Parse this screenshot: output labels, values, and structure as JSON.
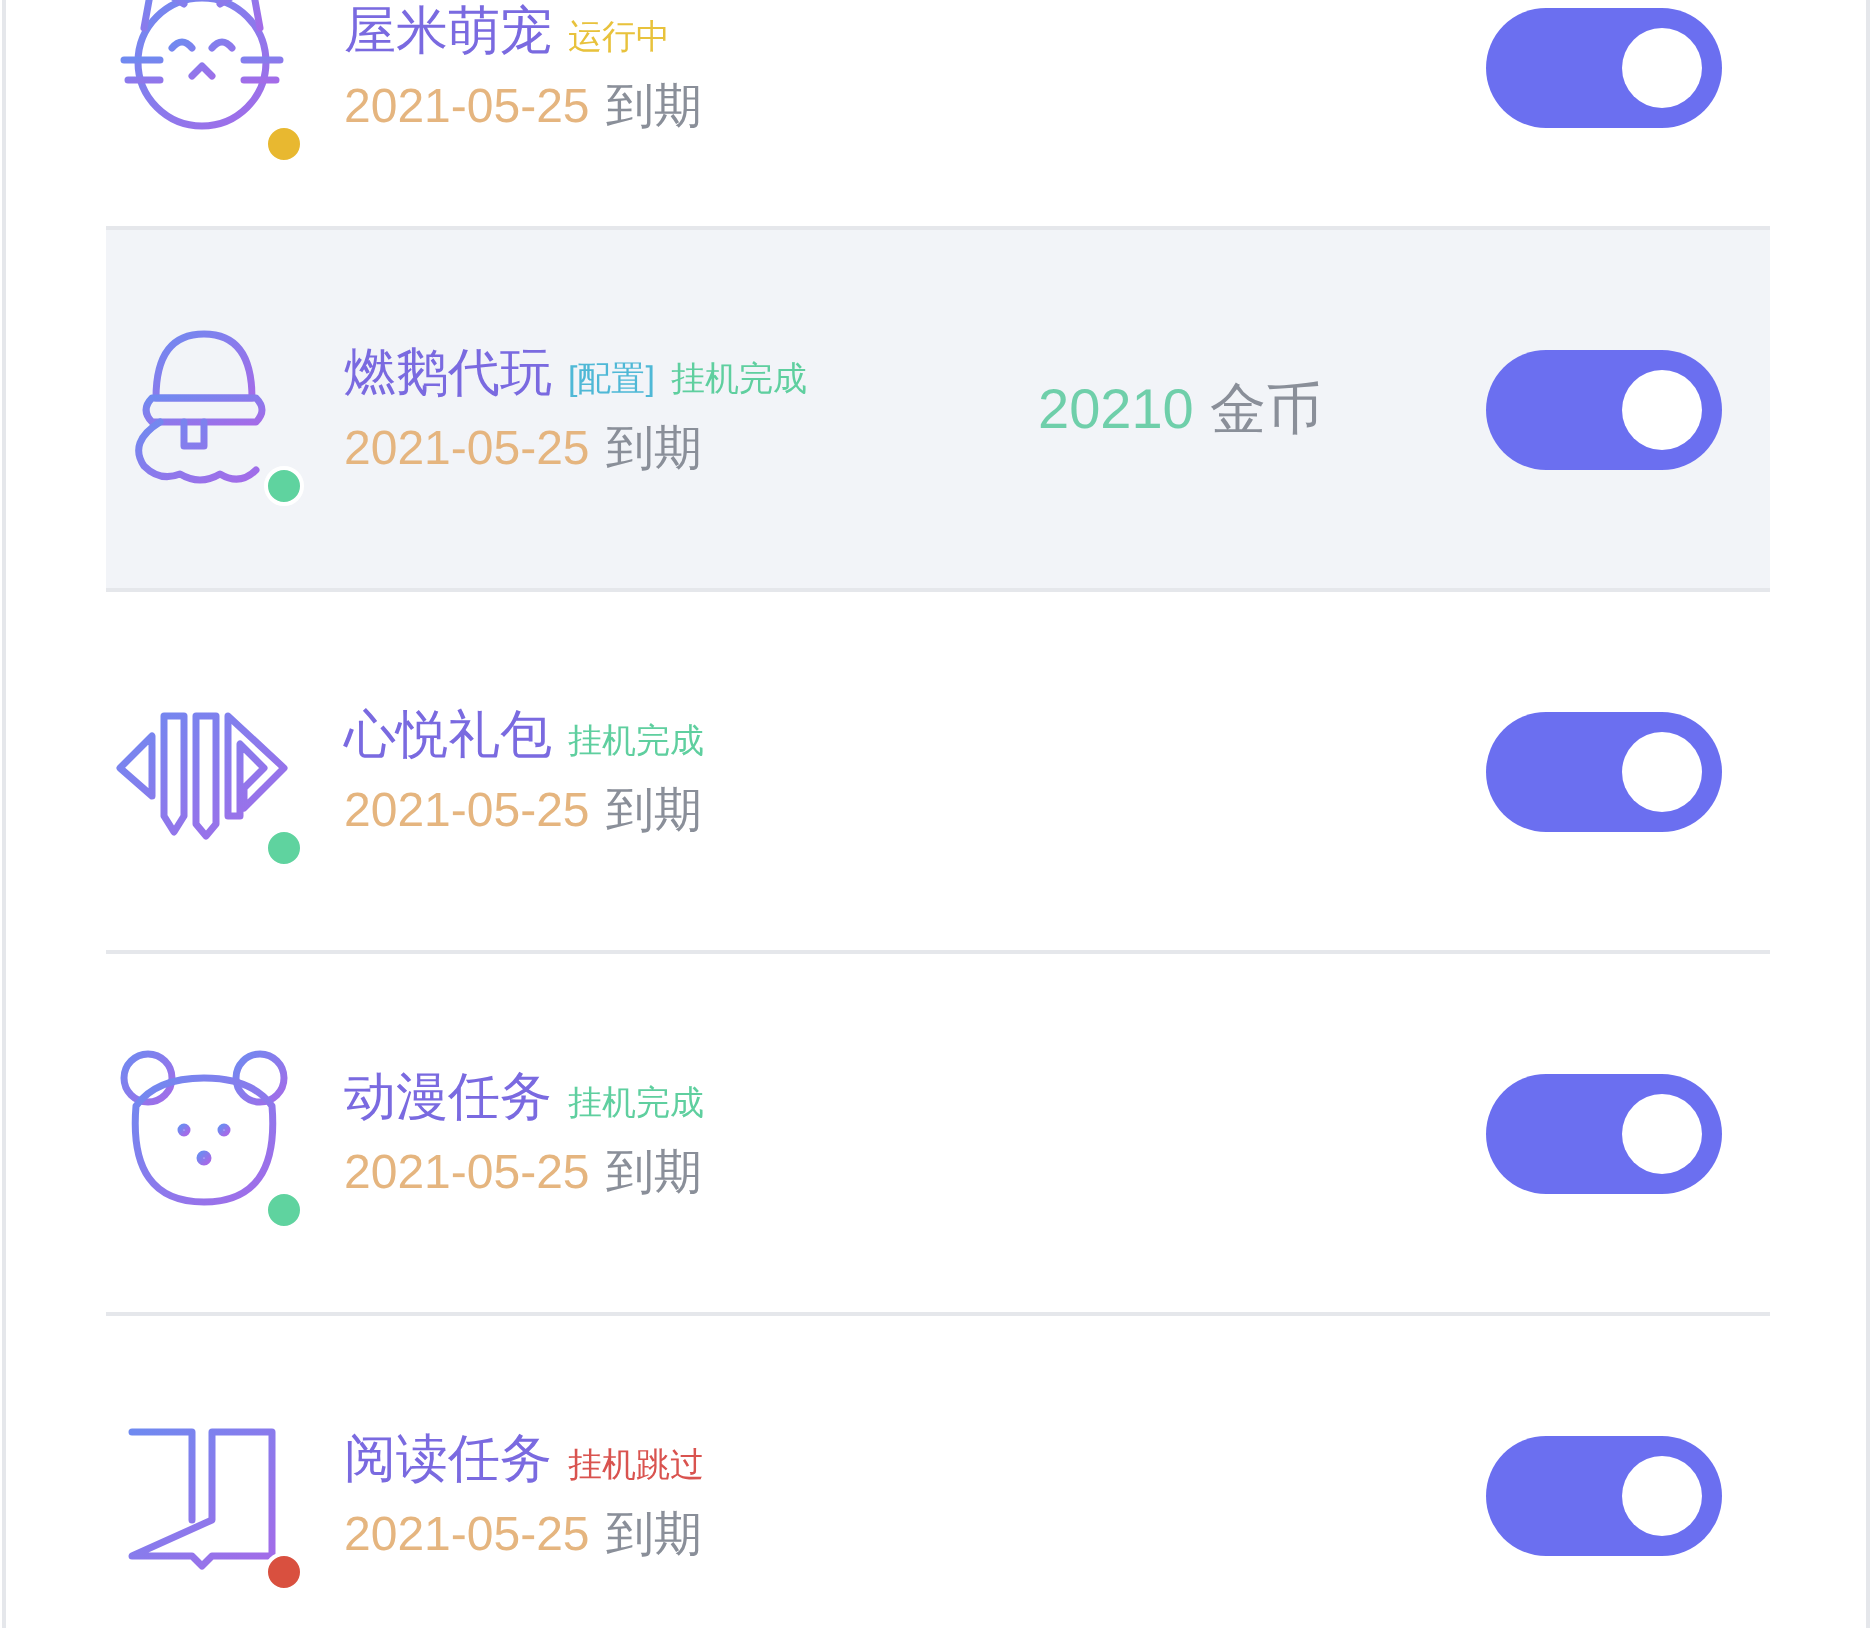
{
  "tasks": [
    {
      "title": "屋米萌宠",
      "tags": [
        {
          "text": "运行中",
          "color": "#e8c23c"
        }
      ],
      "date": "2021-05-25",
      "date_suffix": "到期",
      "color": "#e8b830",
      "on": true,
      "selected": false
    },
    {
      "title": "燃鹅代玩",
      "tags": [
        {
          "text": "[配置]",
          "color": "#4fb8d6"
        },
        {
          "text": "挂机完成",
          "color": "#5fcf9f"
        }
      ],
      "date": "2021-05-25",
      "date_suffix": "到期",
      "coins": {
        "value": "20210",
        "unit": "金币"
      },
      "color": "#5fd39f",
      "on": true,
      "selected": true
    },
    {
      "title": "心悦礼包",
      "tags": [
        {
          "text": "挂机完成",
          "color": "#5fcf9f"
        }
      ],
      "date": "2021-05-25",
      "date_suffix": "到期",
      "color": "#5fd39f",
      "on": true,
      "selected": false
    },
    {
      "title": "动漫任务",
      "tags": [
        {
          "text": "挂机完成",
          "color": "#5fcf9f"
        }
      ],
      "date": "2021-05-25",
      "date_suffix": "到期",
      "color": "#5fd39f",
      "on": true,
      "selected": false
    },
    {
      "title": "阅读任务",
      "tags": [
        {
          "text": "挂机跳过",
          "color": "#d9534f"
        }
      ],
      "date": "2021-05-25",
      "date_suffix": "到期",
      "color": "#d9503f",
      "on": true,
      "selected": false
    }
  ]
}
